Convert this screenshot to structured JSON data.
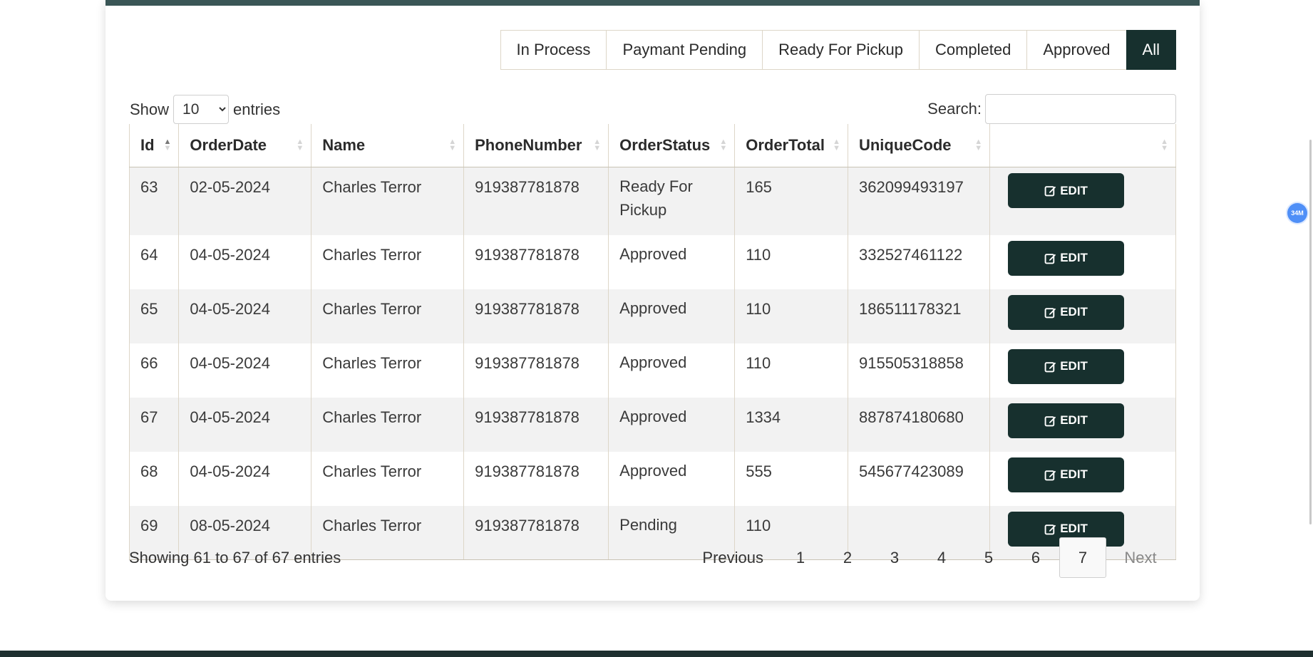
{
  "filters": [
    "In Process",
    "Paymant Pending",
    "Ready For Pickup",
    "Completed",
    "Approved",
    "All"
  ],
  "active_filter": "All",
  "length": {
    "show": "Show",
    "value": "10",
    "entries": "entries"
  },
  "search": {
    "label": "Search:",
    "placeholder": ""
  },
  "columns": [
    "Id",
    "OrderDate",
    "Name",
    "PhoneNumber",
    "OrderStatus",
    "OrderTotal",
    "UniqueCode",
    ""
  ],
  "rows": [
    {
      "id": "63",
      "date": "02-05-2024",
      "name": "Charles Terror",
      "phone": "919387781878",
      "status": "Ready For Pickup",
      "total": "165",
      "code": "362099493197"
    },
    {
      "id": "64",
      "date": "04-05-2024",
      "name": "Charles Terror",
      "phone": "919387781878",
      "status": "Approved",
      "total": "110",
      "code": "332527461122"
    },
    {
      "id": "65",
      "date": "04-05-2024",
      "name": "Charles Terror",
      "phone": "919387781878",
      "status": "Approved",
      "total": "110",
      "code": "186511178321"
    },
    {
      "id": "66",
      "date": "04-05-2024",
      "name": "Charles Terror",
      "phone": "919387781878",
      "status": "Approved",
      "total": "110",
      "code": "915505318858"
    },
    {
      "id": "67",
      "date": "04-05-2024",
      "name": "Charles Terror",
      "phone": "919387781878",
      "status": "Approved",
      "total": "1334",
      "code": "887874180680"
    },
    {
      "id": "68",
      "date": "04-05-2024",
      "name": "Charles Terror",
      "phone": "919387781878",
      "status": "Approved",
      "total": "555",
      "code": "545677423089"
    },
    {
      "id": "69",
      "date": "08-05-2024",
      "name": "Charles Terror",
      "phone": "919387781878",
      "status": "Pending",
      "total": "110",
      "code": ""
    }
  ],
  "edit_label": "EDIT",
  "info": "Showing 61 to 67 of 67 entries",
  "pagination": {
    "previous": "Previous",
    "pages": [
      "1",
      "2",
      "3",
      "4",
      "5",
      "6",
      "7"
    ],
    "current": "7",
    "next": "Next"
  },
  "badge": "34M",
  "colors": {
    "primary": "#17302e",
    "topbar": "#3a5656",
    "badge": "#4f8ff7"
  }
}
